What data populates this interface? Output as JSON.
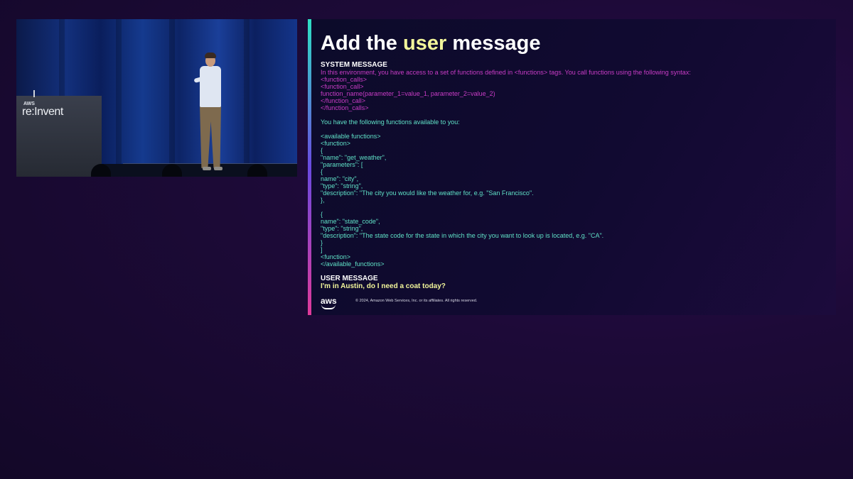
{
  "video": {
    "podium_brand_small": "AWS",
    "podium_brand": "re:Invent"
  },
  "slide": {
    "title_prefix": "Add the ",
    "title_highlight": "user",
    "title_suffix": " message",
    "system_label": "SYSTEM MESSAGE",
    "system_lines": [
      "In this environment, you have access to a set of functions defined in <functions> tags. You call functions using the following syntax:",
      "<function_calls>",
      "<function_call>",
      "function_name(parameter_1=value_1, parameter_2=value_2)",
      "</function_call>",
      "</function_calls>"
    ],
    "functions_lines": [
      "You have the following functions available to you:",
      "",
      "<available functions>",
      "<function>",
      "{",
      "\"name\": \"get_weather\",",
      "\"parameters\": [",
      "{",
      "name\": \"city\",",
      "\"type\": \"string\",",
      "\"description\": \"The city you would like the weather for, e.g. \"San Francisco\".",
      "},",
      "",
      "{",
      "name\": \"state_code\",",
      "\"type\": \"string\",",
      "\"description\": \"The state code for the state in which the city you want to look up is located, e.g. \"CA\".",
      "}",
      "]",
      "<function>",
      "</available_functions>"
    ],
    "user_label": "USER MESSAGE",
    "user_message": "I'm in Austin, do I need a coat today?",
    "aws_logo": "aws",
    "copyright": "© 2024, Amazon Web Services, Inc. or its affiliates. All rights reserved."
  }
}
